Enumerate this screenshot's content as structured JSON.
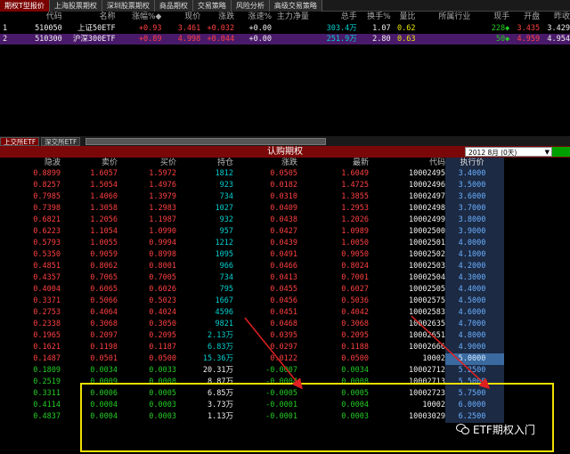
{
  "top_tabs": [
    "期权T型报价",
    "上海股票期权",
    "深圳股票期权",
    "商品期权",
    "交易策略",
    "风险分析",
    "高级交易策略"
  ],
  "quote_header": {
    "code": "代码",
    "name": "名称",
    "chg": "涨幅%◆",
    "price": "现价",
    "diff": "涨跌",
    "speed": "涨速%",
    "main": "主力净量",
    "vol": "总手",
    "turn": "换手%",
    "ratio": "量比",
    "ind": "所属行业",
    "now": "现手",
    "open": "开盘",
    "prev": "昨收"
  },
  "quotes": [
    {
      "idx": "1",
      "code": "510050",
      "name": "上证50ETF",
      "chg": "+0.93",
      "price": "3.461",
      "diff": "+0.032",
      "speed": "+0.00",
      "main": "",
      "vol": "303.4万",
      "turn": "1.07",
      "ratio": "0.62",
      "ind": "",
      "now": "228◆",
      "open": "3.435",
      "prev": "3.429"
    },
    {
      "idx": "2",
      "code": "510300",
      "name": "沪深300ETF",
      "chg": "+0.89",
      "price": "4.998",
      "diff": "+0.044",
      "speed": "+0.00",
      "main": "",
      "vol": "251.9万",
      "turn": "2.80",
      "ratio": "0.63",
      "ind": "",
      "now": "50◆",
      "open": "4.959",
      "prev": "4.954"
    }
  ],
  "bottom_tabs": [
    "上交所ETF",
    "深交所ETF"
  ],
  "options_title": "认购期权",
  "month_select": "2012 8月 (0天)",
  "grid_header": {
    "implied": "隐波",
    "ask": "卖价",
    "bid": "买价",
    "oi": "持仓",
    "chg": "涨跌",
    "last": "最新",
    "code": "代码",
    "strike": "执行价"
  },
  "rows": [
    {
      "iv": "0.8899",
      "ask": "1.6057",
      "bid": "1.5972",
      "oi": "1812",
      "chg": "0.0505",
      "last": "1.6049",
      "code": "10002495",
      "strike": "3.4000"
    },
    {
      "iv": "0.8257",
      "ask": "1.5054",
      "bid": "1.4976",
      "oi": "923",
      "chg": "0.0182",
      "last": "1.4725",
      "code": "10002496",
      "strike": "3.5000"
    },
    {
      "iv": "0.7985",
      "ask": "1.4060",
      "bid": "1.3979",
      "oi": "734",
      "chg": "0.0310",
      "last": "1.3855",
      "code": "10002497",
      "strike": "3.6000"
    },
    {
      "iv": "0.7398",
      "ask": "1.3058",
      "bid": "1.2983",
      "oi": "1027",
      "chg": "0.0409",
      "last": "1.2953",
      "code": "10002498",
      "strike": "3.7000"
    },
    {
      "iv": "0.6821",
      "ask": "1.2056",
      "bid": "1.1987",
      "oi": "932",
      "chg": "0.0438",
      "last": "1.2026",
      "code": "10002499",
      "strike": "3.8000"
    },
    {
      "iv": "0.6223",
      "ask": "1.1054",
      "bid": "1.0990",
      "oi": "957",
      "chg": "0.0427",
      "last": "1.0989",
      "code": "10002500",
      "strike": "3.9000"
    },
    {
      "iv": "0.5793",
      "ask": "1.0055",
      "bid": "0.9994",
      "oi": "1212",
      "chg": "0.0439",
      "last": "1.0050",
      "code": "10002501",
      "strike": "4.0000"
    },
    {
      "iv": "0.5350",
      "ask": "0.9059",
      "bid": "0.8998",
      "oi": "1095",
      "chg": "0.0491",
      "last": "0.9050",
      "code": "10002502",
      "strike": "4.1000"
    },
    {
      "iv": "0.4851",
      "ask": "0.8062",
      "bid": "0.8001",
      "oi": "966",
      "chg": "0.0466",
      "last": "0.8024",
      "code": "10002503",
      "strike": "4.2000"
    },
    {
      "iv": "0.4357",
      "ask": "0.7065",
      "bid": "0.7005",
      "oi": "734",
      "chg": "0.0413",
      "last": "0.7001",
      "code": "10002504",
      "strike": "4.3000"
    },
    {
      "iv": "0.4004",
      "ask": "0.6065",
      "bid": "0.6026",
      "oi": "795",
      "chg": "0.0455",
      "last": "0.6027",
      "code": "10002505",
      "strike": "4.4000"
    },
    {
      "iv": "0.3371",
      "ask": "0.5066",
      "bid": "0.5023",
      "oi": "1667",
      "chg": "0.0456",
      "last": "0.5036",
      "code": "10002575",
      "strike": "4.5000"
    },
    {
      "iv": "0.2753",
      "ask": "0.4064",
      "bid": "0.4024",
      "oi": "4596",
      "chg": "0.0451",
      "last": "0.4042",
      "code": "10002583",
      "strike": "4.6000"
    },
    {
      "iv": "0.2338",
      "ask": "0.3068",
      "bid": "0.3050",
      "oi": "9821",
      "chg": "0.0468",
      "last": "0.3068",
      "code": "10002635",
      "strike": "4.7000"
    },
    {
      "iv": "0.1965",
      "ask": "0.2097",
      "bid": "0.2095",
      "oi": "2.13万",
      "chg": "0.0395",
      "last": "0.2095",
      "code": "10002651",
      "strike": "4.8000"
    },
    {
      "iv": "0.1621",
      "ask": "0.1198",
      "bid": "0.1187",
      "oi": "6.83万",
      "chg": "0.0297",
      "last": "0.1188",
      "code": "10002666",
      "strike": "4.9000"
    },
    {
      "iv": "0.1487",
      "ask": "0.0501",
      "bid": "0.0500",
      "oi": "15.36万",
      "chg": "0.0122",
      "last": "0.0500",
      "code": "10002",
      "strike": "5.0000"
    },
    {
      "iv": "0.1809",
      "ask": "0.0034",
      "bid": "0.0033",
      "oi": "20.31万",
      "chg": "-0.0007",
      "last": "0.0034",
      "code": "10002712",
      "strike": "5.2500"
    },
    {
      "iv": "0.2519",
      "ask": "0.0009",
      "bid": "0.0008",
      "oi": "8.87万",
      "chg": "-0.0004",
      "last": "0.0008",
      "code": "10002713",
      "strike": "5.5000"
    },
    {
      "iv": "0.3311",
      "ask": "0.0006",
      "bid": "0.0005",
      "oi": "6.85万",
      "chg": "-0.0005",
      "last": "0.0005",
      "code": "10002723",
      "strike": "5.7500"
    },
    {
      "iv": "0.4114",
      "ask": "0.0004",
      "bid": "0.0003",
      "oi": "3.73万",
      "chg": "-0.0001",
      "last": "0.0004",
      "code": "10002",
      "strike": "6.0000"
    },
    {
      "iv": "0.4837",
      "ask": "0.0004",
      "bid": "0.0003",
      "oi": "1.13万",
      "chg": "-0.0001",
      "last": "0.0003",
      "code": "10003029",
      "strike": "6.2500"
    }
  ],
  "watermark": "ETF期权入门"
}
